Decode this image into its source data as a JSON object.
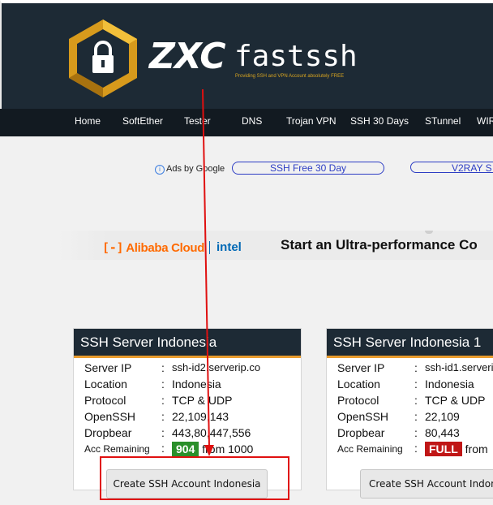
{
  "header": {
    "brand_main": "ZXC",
    "brand_sub": "fastssh",
    "tagline": "Providing SSH and VPN Account absolutely FREE"
  },
  "nav": {
    "items": [
      "Home",
      "SoftEther",
      "Tester",
      "DNS",
      "Trojan VPN",
      "SSH 30 Days",
      "STunnel",
      "WIR"
    ]
  },
  "ads": {
    "info_label": "Ads by Google",
    "links": [
      "SSH Free 30 Day",
      "V2RAY S"
    ]
  },
  "banner": {
    "brand1": "Alibaba Cloud",
    "brand2": "intel",
    "headline": "Start an Ultra-performance Co"
  },
  "cards": [
    {
      "title": "SSH Server Indonesia",
      "server_ip": "ssh-id2.serverip.co",
      "location": "Indonesia",
      "protocol": "TCP & UDP",
      "openssh": "22,109,143",
      "dropbear": "443,80,447,556",
      "acc_badge": "904",
      "acc_suffix": "from 1000",
      "button": "Create SSH Account Indonesia"
    },
    {
      "title": "SSH Server Indonesia 1",
      "server_ip": "ssh-id1.serveri",
      "location": "Indonesia",
      "protocol": "TCP & UDP",
      "openssh": "22,109",
      "dropbear": "80,443",
      "acc_badge": "FULL",
      "acc_suffix": "from",
      "button": "Create SSH Account Indone"
    }
  ],
  "labels": {
    "server_ip": "Server IP",
    "location": "Location",
    "protocol": "Protocol",
    "openssh": "OpenSSH",
    "dropbear": "Dropbear",
    "acc_remaining": "Acc Remaining",
    "colon": ":"
  },
  "colors": {
    "header_bg": "#1d2a35",
    "accent_gold": "#e99c2e",
    "available_green": "#2a8f2a",
    "full_red": "#c01616",
    "annotation_red": "#e01010"
  }
}
